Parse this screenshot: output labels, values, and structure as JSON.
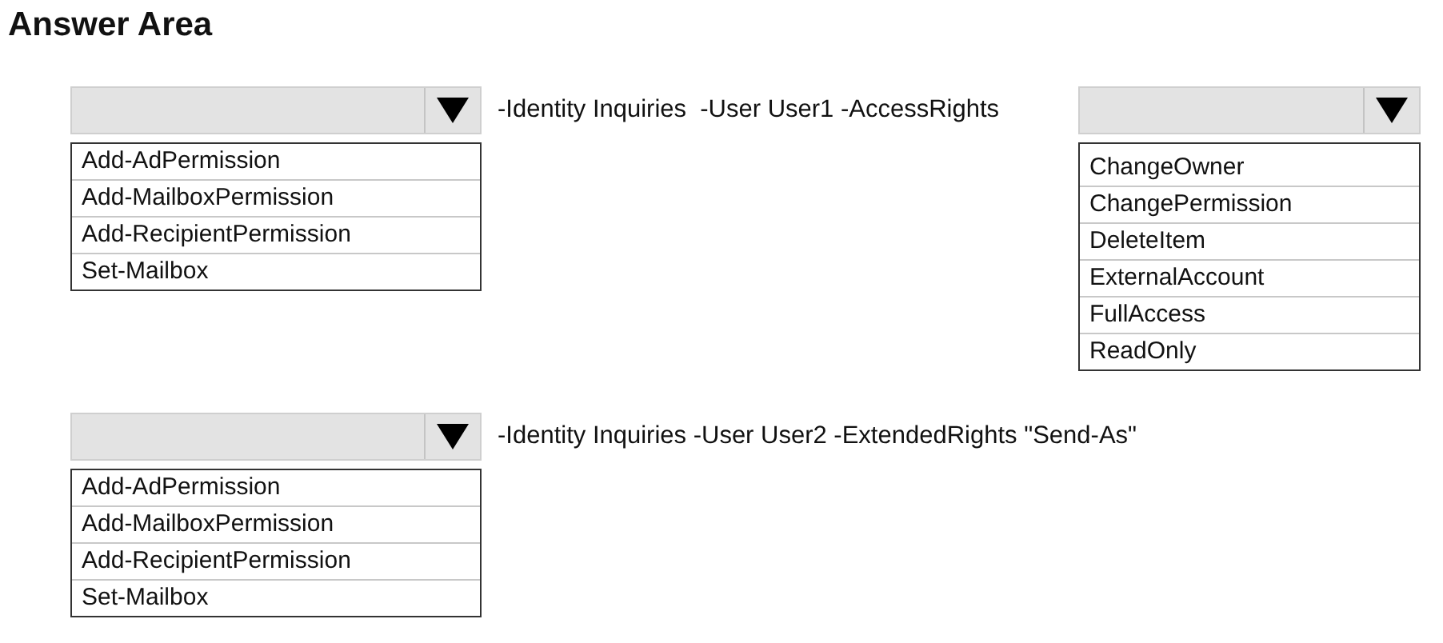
{
  "title": "Answer Area",
  "statements": [
    {
      "parts": [
        {
          "kind": "dropdown",
          "options": [
            "Add-AdPermission",
            "Add-MailboxPermission",
            "Add-RecipientPermission",
            "Set-Mailbox"
          ]
        },
        {
          "kind": "text",
          "text": "-Identity Inquiries  -User User1 -AccessRights"
        },
        {
          "kind": "dropdown",
          "options": [
            "ChangeOwner",
            "ChangePermission",
            "DeleteItem",
            "ExternalAccount",
            "FullAccess",
            "ReadOnly"
          ]
        }
      ]
    },
    {
      "parts": [
        {
          "kind": "dropdown",
          "options": [
            "Add-AdPermission",
            "Add-MailboxPermission",
            "Add-RecipientPermission",
            "Set-Mailbox"
          ]
        },
        {
          "kind": "text",
          "text": "-Identity Inquiries -User User2 -ExtendedRights \"Send-As\""
        }
      ]
    }
  ]
}
